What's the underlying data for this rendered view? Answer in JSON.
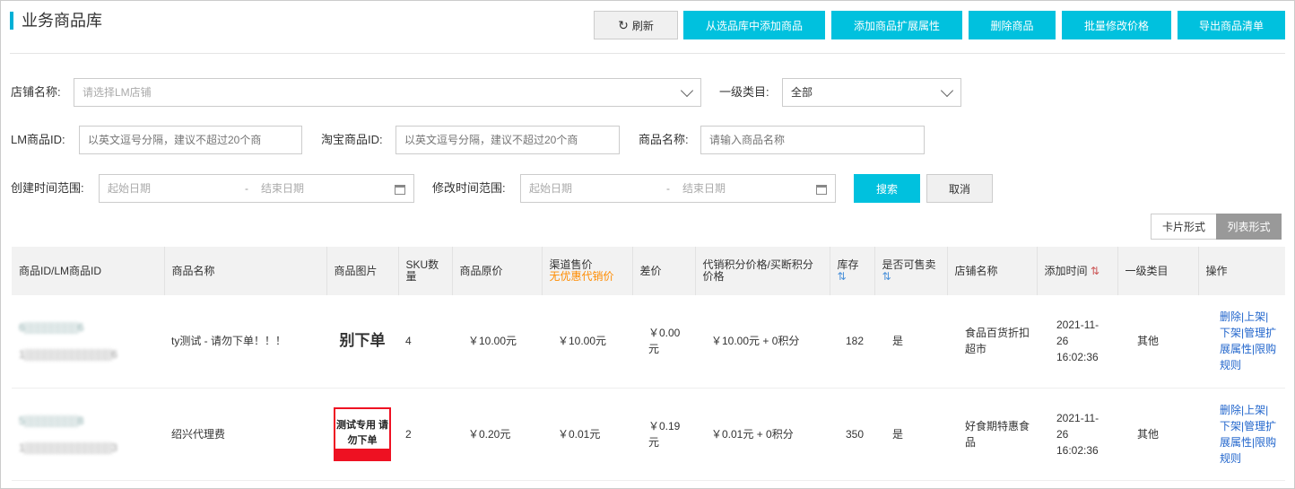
{
  "title": "业务商品库",
  "toolbar": {
    "refresh": "刷新",
    "add_from_lib": "从选品库中添加商品",
    "add_ext": "添加商品扩展属性",
    "delete": "删除商品",
    "batch_price": "批量修改价格",
    "export": "导出商品清单"
  },
  "filters": {
    "shop_label": "店铺名称:",
    "shop_placeholder": "请选择LM店铺",
    "cat_label": "一级类目:",
    "cat_value": "全部",
    "lm_id_label": "LM商品ID:",
    "lm_id_placeholder": "以英文逗号分隔，建议不超过20个商",
    "tb_id_label": "淘宝商品ID:",
    "tb_id_placeholder": "以英文逗号分隔，建议不超过20个商",
    "name_label": "商品名称:",
    "name_placeholder": "请输入商品名称",
    "create_label": "创建时间范围:",
    "modify_label": "修改时间范围:",
    "start_placeholder": "起始日期",
    "end_placeholder": "结束日期",
    "sep": "-",
    "search": "搜索",
    "cancel": "取消"
  },
  "view": {
    "card": "卡片形式",
    "list": "列表形式"
  },
  "table": {
    "headers": [
      "商品ID/LM商品ID",
      "商品名称",
      "商品图片",
      "SKU数量",
      "商品原价",
      "渠道售价",
      "差价",
      "代销积分价格/买断积分价格",
      "库存",
      "是否可售卖",
      "店铺名称",
      "添加时间",
      "一级类目",
      "操作"
    ],
    "channel_sub": "无优惠代销价",
    "sort_icon": "⇅",
    "rows": [
      {
        "id": "6▒▒▒▒▒▒▒▒6",
        "lm_id": "1▒▒▒▒▒▒▒▒▒▒▒▒▒6",
        "name": "ty测试 - 请勿下单！！！",
        "image_text": "别下单",
        "sku": "4",
        "orig": "￥10.00元",
        "channel": "￥10.00元",
        "diff": "￥0.00元",
        "points": "￥10.00元 + 0积分",
        "stock": "182",
        "sellable": "是",
        "shop": "食品百货折扣超市",
        "date": "2021-11-26",
        "time": "16:02:36",
        "cat": "其他",
        "actions": "删除|上架|下架|管理扩展属性|限购规则"
      },
      {
        "id": "5▒▒▒▒▒▒▒▒8",
        "lm_id": "1▒▒▒▒▒▒▒▒▒▒▒▒▒3",
        "name": "绍兴代理费",
        "image_text": "测试专用 请勿下单",
        "sku": "2",
        "orig": "￥0.20元",
        "channel": "￥0.01元",
        "diff": "￥0.19元",
        "points": "￥0.01元 + 0积分",
        "stock": "350",
        "sellable": "是",
        "shop": "好食期特惠食品",
        "date": "2021-11-26",
        "time": "16:02:36",
        "cat": "其他",
        "actions": "删除|上架|下架|管理扩展属性|限购规则"
      }
    ]
  }
}
